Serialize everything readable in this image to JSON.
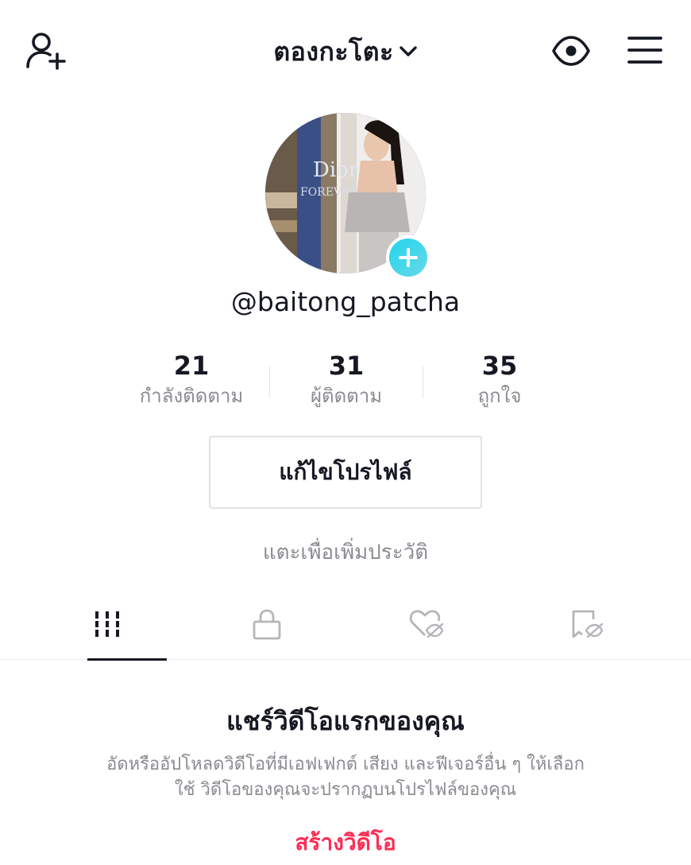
{
  "header": {
    "title": "ตองกะโตะ",
    "left_icon": "add-user-icon",
    "right_icons": [
      "eye-icon",
      "menu-icon"
    ]
  },
  "profile": {
    "username": "@baitong_patcha",
    "stats": [
      {
        "value": "21",
        "label": "กำลังติดตาม"
      },
      {
        "value": "31",
        "label": "ผู้ติดตาม"
      },
      {
        "value": "35",
        "label": "ถูกใจ"
      }
    ],
    "edit_button": "แก้ไขโปรไฟล์",
    "bio_placeholder": "แตะเพื่อเพิ่มประวัติ"
  },
  "tabs": [
    {
      "icon": "grid-icon",
      "active": true
    },
    {
      "icon": "lock-icon",
      "active": false
    },
    {
      "icon": "heart-hidden-icon",
      "active": false
    },
    {
      "icon": "bookmark-hidden-icon",
      "active": false
    }
  ],
  "empty_state": {
    "title": "แชร์วิดีโอแรกของคุณ",
    "description_line1": "อัดหรืออัปโหลดวิดีโอที่มีเอฟเฟกต์ เสียง และฟีเจอร์อื่น ๆ ให้เลือก",
    "description_line2": "ใช้ วิดีโอของคุณจะปรากฏบนโปรไฟล์ของคุณ",
    "action": "สร้างวิดีโอ"
  },
  "colors": {
    "text_primary": "#161823",
    "text_secondary": "#8a8b91",
    "accent_red": "#fe2c55",
    "accent_teal": "#20d5ec"
  }
}
